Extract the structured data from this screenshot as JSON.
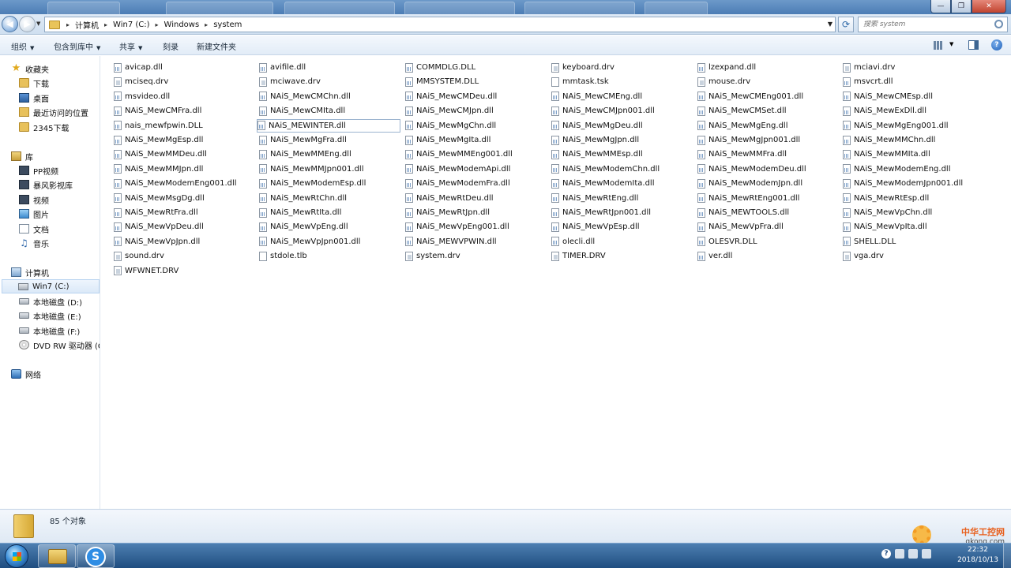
{
  "address": {
    "breadcrumbs": [
      "计算机",
      "Win7 (C:)",
      "Windows",
      "system"
    ],
    "search_placeholder": "搜索 system"
  },
  "toolbar": {
    "organize": "组织",
    "include_in_library": "包含到库中",
    "share": "共享",
    "burn": "刻录",
    "new_folder": "新建文件夹"
  },
  "nav": {
    "favorites": "收藏夹",
    "downloads": "下载",
    "desktop": "桌面",
    "recent": "最近访问的位置",
    "downloads2345": "2345下载",
    "libraries": "库",
    "pp_video": "PP视频",
    "storm": "暴风影视库",
    "videos": "视频",
    "pictures": "图片",
    "documents": "文档",
    "music": "音乐",
    "computer": "计算机",
    "c_drive": "Win7 (C:)",
    "d_drive": "本地磁盘 (D:)",
    "e_drive": "本地磁盘 (E:)",
    "f_drive": "本地磁盘 (F:)",
    "dvd": "DVD RW 驱动器 (G",
    "network": "网络"
  },
  "files": [
    "avicap.dll",
    "avifile.dll",
    "COMMDLG.DLL",
    "keyboard.drv",
    "lzexpand.dll",
    "mciavi.drv",
    "mciseq.drv",
    "mciwave.drv",
    "MMSYSTEM.DLL",
    "mmtask.tsk",
    "mouse.drv",
    "msvcrt.dll",
    "msvideo.dll",
    "NAiS_MewCMChn.dll",
    "NAiS_MewCMDeu.dll",
    "NAiS_MewCMEng.dll",
    "NAiS_MewCMEng001.dll",
    "NAiS_MewCMEsp.dll",
    "NAiS_MewCMFra.dll",
    "NAiS_MewCMIta.dll",
    "NAiS_MewCMJpn.dll",
    "NAiS_MewCMJpn001.dll",
    "NAiS_MewCMSet.dll",
    "NAiS_MewExDll.dll",
    "nais_mewfpwin.DLL",
    "NAiS_MEWINTER.dll",
    "NAiS_MewMgChn.dll",
    "NAiS_MewMgDeu.dll",
    "NAiS_MewMgEng.dll",
    "NAiS_MewMgEng001.dll",
    "NAiS_MewMgEsp.dll",
    "NAiS_MewMgFra.dll",
    "NAiS_MewMgIta.dll",
    "NAiS_MewMgJpn.dll",
    "NAiS_MewMgJpn001.dll",
    "NAiS_MewMMChn.dll",
    "NAiS_MewMMDeu.dll",
    "NAiS_MewMMEng.dll",
    "NAiS_MewMMEng001.dll",
    "NAiS_MewMMEsp.dll",
    "NAiS_MewMMFra.dll",
    "NAiS_MewMMIta.dll",
    "NAiS_MewMMJpn.dll",
    "NAiS_MewMMJpn001.dll",
    "NAiS_MewModemApi.dll",
    "NAiS_MewModemChn.dll",
    "NAiS_MewModemDeu.dll",
    "NAiS_MewModemEng.dll",
    "NAiS_MewModemEng001.dll",
    "NAiS_MewModemEsp.dll",
    "NAiS_MewModemFra.dll",
    "NAiS_MewModemIta.dll",
    "NAiS_MewModemJpn.dll",
    "NAiS_MewModemJpn001.dll",
    "NAiS_MewMsgDg.dll",
    "NAiS_MewRtChn.dll",
    "NAiS_MewRtDeu.dll",
    "NAiS_MewRtEng.dll",
    "NAiS_MewRtEng001.dll",
    "NAiS_MewRtEsp.dll",
    "NAiS_MewRtFra.dll",
    "NAiS_MewRtIta.dll",
    "NAiS_MewRtJpn.dll",
    "NAiS_MewRtJpn001.dll",
    "NAiS_MEWTOOLS.dll",
    "NAiS_MewVpChn.dll",
    "NAiS_MewVpDeu.dll",
    "NAiS_MewVpEng.dll",
    "NAiS_MewVpEng001.dll",
    "NAiS_MewVpEsp.dll",
    "NAiS_MewVpFra.dll",
    "NAiS_MewVpIta.dll",
    "NAiS_MewVpJpn.dll",
    "NAiS_MewVpJpn001.dll",
    "NAiS_MEWVPWIN.dll",
    "olecli.dll",
    "OLESVR.DLL",
    "SHELL.DLL",
    "sound.drv",
    "stdole.tlb",
    "system.drv",
    "TIMER.DRV",
    "ver.dll",
    "vga.drv",
    "WFWNET.DRV"
  ],
  "details": {
    "item_count": "85 个对象"
  },
  "watermark": {
    "text": "中华工控网",
    "url": "gkong.com"
  },
  "taskbar": {
    "time": "22:32",
    "date": "2018/10/13"
  }
}
